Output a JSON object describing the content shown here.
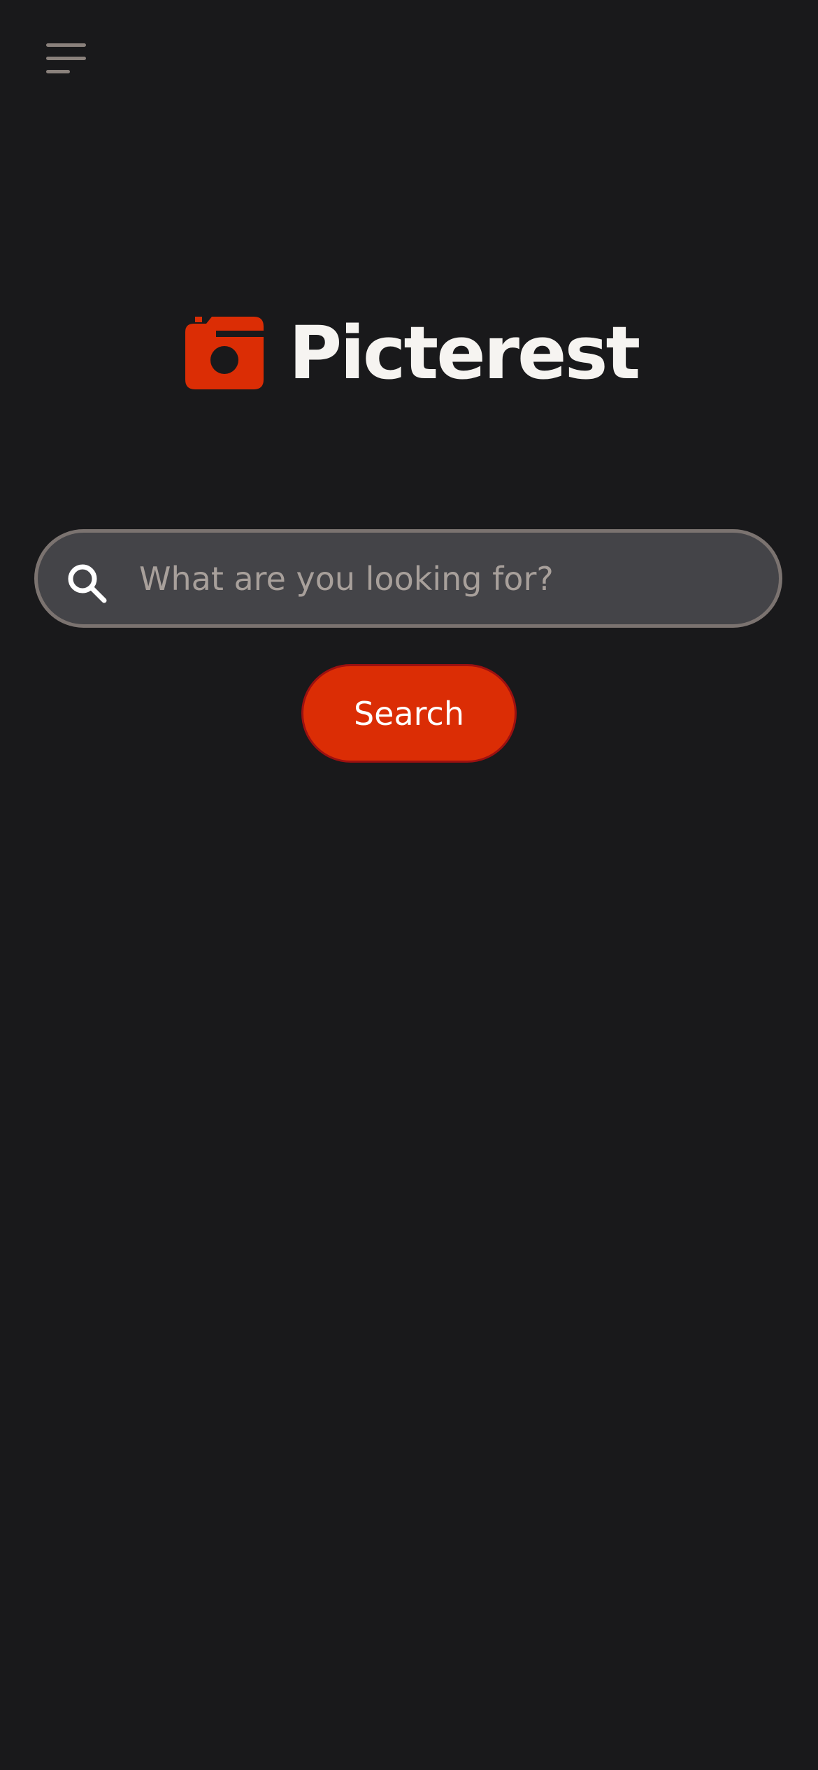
{
  "header": {
    "menu_icon": "hamburger-menu-icon"
  },
  "logo": {
    "icon": "camera-icon",
    "text": "Picterest",
    "icon_color": "#db2d05",
    "text_color": "#f6f4f1"
  },
  "search": {
    "icon": "search-icon",
    "placeholder": "What are you looking for?",
    "value": "",
    "button_label": "Search",
    "button_color": "#db2d05"
  },
  "theme": {
    "background": "#19191b",
    "field_background": "#444448",
    "field_border": "#7b7370"
  }
}
